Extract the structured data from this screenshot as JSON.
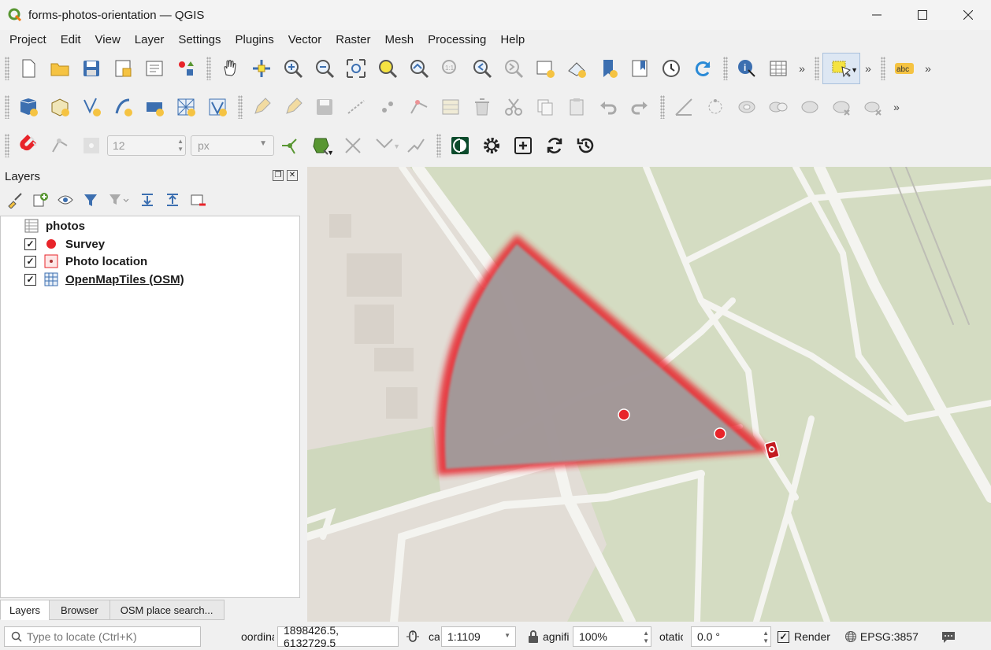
{
  "window": {
    "title": "forms-photos-orientation — QGIS"
  },
  "menu": [
    "Project",
    "Edit",
    "View",
    "Layer",
    "Settings",
    "Plugins",
    "Vector",
    "Raster",
    "Mesh",
    "Processing",
    "Help"
  ],
  "toolbar3": {
    "size_value": "12",
    "unit_value": "px"
  },
  "layers_panel": {
    "title": "Layers",
    "items": [
      {
        "label": "photos",
        "type": "table"
      },
      {
        "label": "Survey",
        "type": "point",
        "checked": "✓"
      },
      {
        "label": "Photo location",
        "type": "point-symbol",
        "checked": "✓"
      },
      {
        "label": "OpenMapTiles (OSM)",
        "type": "raster",
        "checked": "✓"
      }
    ]
  },
  "tabs": [
    "Layers",
    "Browser",
    "OSM place search..."
  ],
  "status": {
    "locator_placeholder": "Type to locate (Ctrl+K)",
    "coordinate_label": "oordina",
    "coordinate_value": "1898426.5, 6132729.5",
    "scale_label": "ca",
    "scale_value": "1:1109",
    "magnifier_label": "agnifi",
    "magnifier_value": "100%",
    "rotation_label": "otatic",
    "rotation_value": "0.0 °",
    "render_label": "Render",
    "render_check": "✓",
    "crs": "EPSG:3857"
  },
  "colors": {
    "accent_red": "#e8242a",
    "map_green": "#d4dcc2",
    "map_grey": "#e2ddd6"
  }
}
